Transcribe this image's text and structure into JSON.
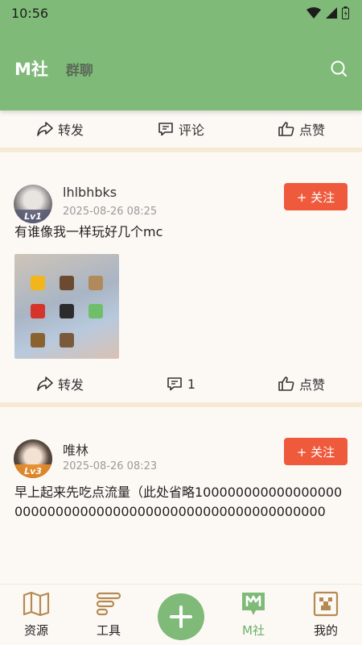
{
  "status": {
    "time": "10:56"
  },
  "header": {
    "title": "M社",
    "subtitle": "群聊"
  },
  "top_actions": {
    "share": "转发",
    "comment": "评论",
    "like": "点赞"
  },
  "posts": [
    {
      "username": "lhlbhbks",
      "level": "Lv1",
      "time": "2025-08-26 08:25",
      "follow_label": "+ 关注",
      "text": "有谁像我一样玩好几个mc",
      "actions": {
        "share": "转发",
        "comment": "1",
        "like": "点赞"
      }
    },
    {
      "username": "唯林",
      "level": "Lv3",
      "time": "2025-08-26 08:23",
      "follow_label": "+ 关注",
      "text": "早上起来先吃点流量（此处省略10000000000000000000000000000000000000000000000000000000"
    }
  ],
  "nav": {
    "resources": "资源",
    "tools": "工具",
    "msheh": "M社",
    "mine": "我的"
  },
  "colors": {
    "brand": "#7fba78",
    "follow": "#ef5a3d",
    "divider": "#f6ead7"
  }
}
